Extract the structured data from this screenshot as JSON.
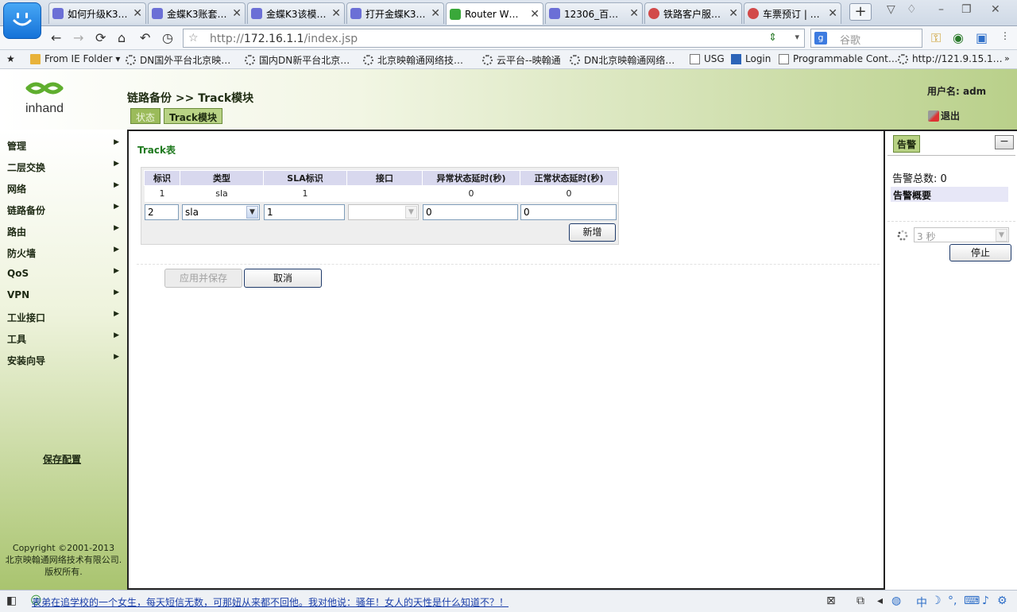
{
  "browser": {
    "tabs": [
      {
        "label": "如何升级K3…",
        "icon_color": "#6b6fd6",
        "active": false
      },
      {
        "label": "金蝶K3账套…",
        "icon_color": "#6b6fd6",
        "active": false
      },
      {
        "label": "金蝶K3该模…",
        "icon_color": "#6b6fd6",
        "active": false
      },
      {
        "label": "打开金蝶K3…",
        "icon_color": "#6b6fd6",
        "active": false
      },
      {
        "label": "Router W…",
        "icon_color": "#3aa83a",
        "active": true
      },
      {
        "label": "12306_百…",
        "icon_color": "#6b6fd6",
        "active": false
      },
      {
        "label": "铁路客户服…",
        "icon_color": "#d24a4a",
        "active": false
      },
      {
        "label": "车票预订 | …",
        "icon_color": "#d24a4a",
        "active": false
      }
    ],
    "close_glyph": "✕",
    "new_tab_glyph": "+",
    "url_prefix": "http://",
    "url_host": "172.16.1.1",
    "url_path": "/index.jsp",
    "search_placeholder": "谷歌",
    "search_engine_glyph": "g",
    "bookmarks": [
      {
        "label": "From IE Folder ▾",
        "icon": "folder-icon"
      },
      {
        "label": "DN国外平台北京映…",
        "icon": "loading-icon"
      },
      {
        "label": "国内DN新平台北京…",
        "icon": "loading-icon"
      },
      {
        "label": "北京映翰通网络技…",
        "icon": "loading-icon"
      },
      {
        "label": "云平台--映翰通",
        "icon": "loading-icon"
      },
      {
        "label": "DN北京映翰通网络…",
        "icon": "loading-icon"
      },
      {
        "label": "USG",
        "icon": "page-icon"
      },
      {
        "label": "Login",
        "icon": "login-icon"
      },
      {
        "label": "Programmable Cont…",
        "icon": "page-icon"
      },
      {
        "label": "http://121.9.15.1…",
        "icon": "loading-icon"
      }
    ]
  },
  "router": {
    "brand": "inhand",
    "breadcrumb": "链路备份 >> Track模块",
    "tabs": {
      "status": "状态",
      "track": "Track模块"
    },
    "user_label": "用户名: adm",
    "logout_label": "退出",
    "menu": [
      "管理",
      "二层交换",
      "网络",
      "链路备份",
      "路由",
      "防火墙",
      "QoS",
      "VPN",
      "工业接口",
      "工具",
      "安装向导"
    ],
    "menu_arrow": "▶",
    "save_config": "保存配置",
    "copyright": [
      "Copyright ©2001-2013",
      "北京映翰通网络技术有限公司.",
      "版权所有."
    ],
    "track": {
      "title": "Track表",
      "columns": [
        "标识",
        "类型",
        "SLA标识",
        "接口",
        "异常状态延时(秒)",
        "正常状态延时(秒)"
      ],
      "rows": [
        [
          "1",
          "sla",
          "1",
          "",
          "0",
          "0"
        ]
      ],
      "new_row": {
        "id": "2",
        "type": "sla",
        "sla_id": "1",
        "interface": "",
        "down_delay": "0",
        "up_delay": "0"
      },
      "add_button": "新增"
    },
    "apply_button": "应用并保存",
    "cancel_button": "取消",
    "alarm": {
      "tab": "告警",
      "minimize_glyph": "−",
      "total_label": "告警总数: 0",
      "summary_label": "告警概要",
      "interval": "3 秒",
      "stop_button": "停止"
    }
  },
  "status_bar": {
    "message": "表弟在追学校的一个女生，每天短信无数，可那妞从来都不回他。我对他说：骚年！女人的天性是什么知道不？！"
  },
  "colors": {
    "accent_green": "#1f7a1f",
    "tab_green": "#b8d284",
    "header_header_bg": "#d8d8ee"
  }
}
